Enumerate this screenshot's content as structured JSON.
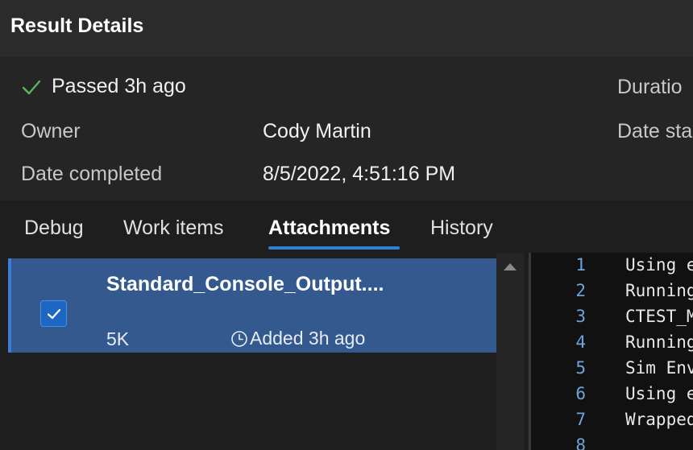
{
  "header": {
    "title": "Result Details"
  },
  "summary": {
    "status": "Passed 3h ago",
    "status_color": "#5fb35a",
    "owner_label": "Owner",
    "owner_value": "Cody Martin",
    "date_completed_label": "Date completed",
    "date_completed_value": "8/5/2022, 4:51:16 PM",
    "duration_label": "Duratio",
    "date_started_label": "Date sta"
  },
  "tabs": [
    {
      "label": "Debug"
    },
    {
      "label": "Work items"
    },
    {
      "label": "Attachments",
      "active": true
    },
    {
      "label": "History"
    }
  ],
  "attachments": [
    {
      "name": "Standard_Console_Output....",
      "size": "5K",
      "added": "Added 3h ago",
      "selected": true
    }
  ],
  "code": {
    "lines": [
      {
        "n": "1",
        "text": "Using e"
      },
      {
        "n": "2",
        "text": "Running"
      },
      {
        "n": "3",
        "text": "CTEST_M"
      },
      {
        "n": "4",
        "text": "Running"
      },
      {
        "n": "5",
        "text": "Sim Env"
      },
      {
        "n": "6",
        "text": "Using e"
      },
      {
        "n": "7",
        "text": "Wrapped"
      },
      {
        "n": "8",
        "text": ""
      }
    ]
  },
  "icons": {
    "status": "check-icon",
    "checkbox": "checkmark-icon",
    "added": "clock-icon",
    "scroll": "scroll-up-arrow-icon"
  }
}
